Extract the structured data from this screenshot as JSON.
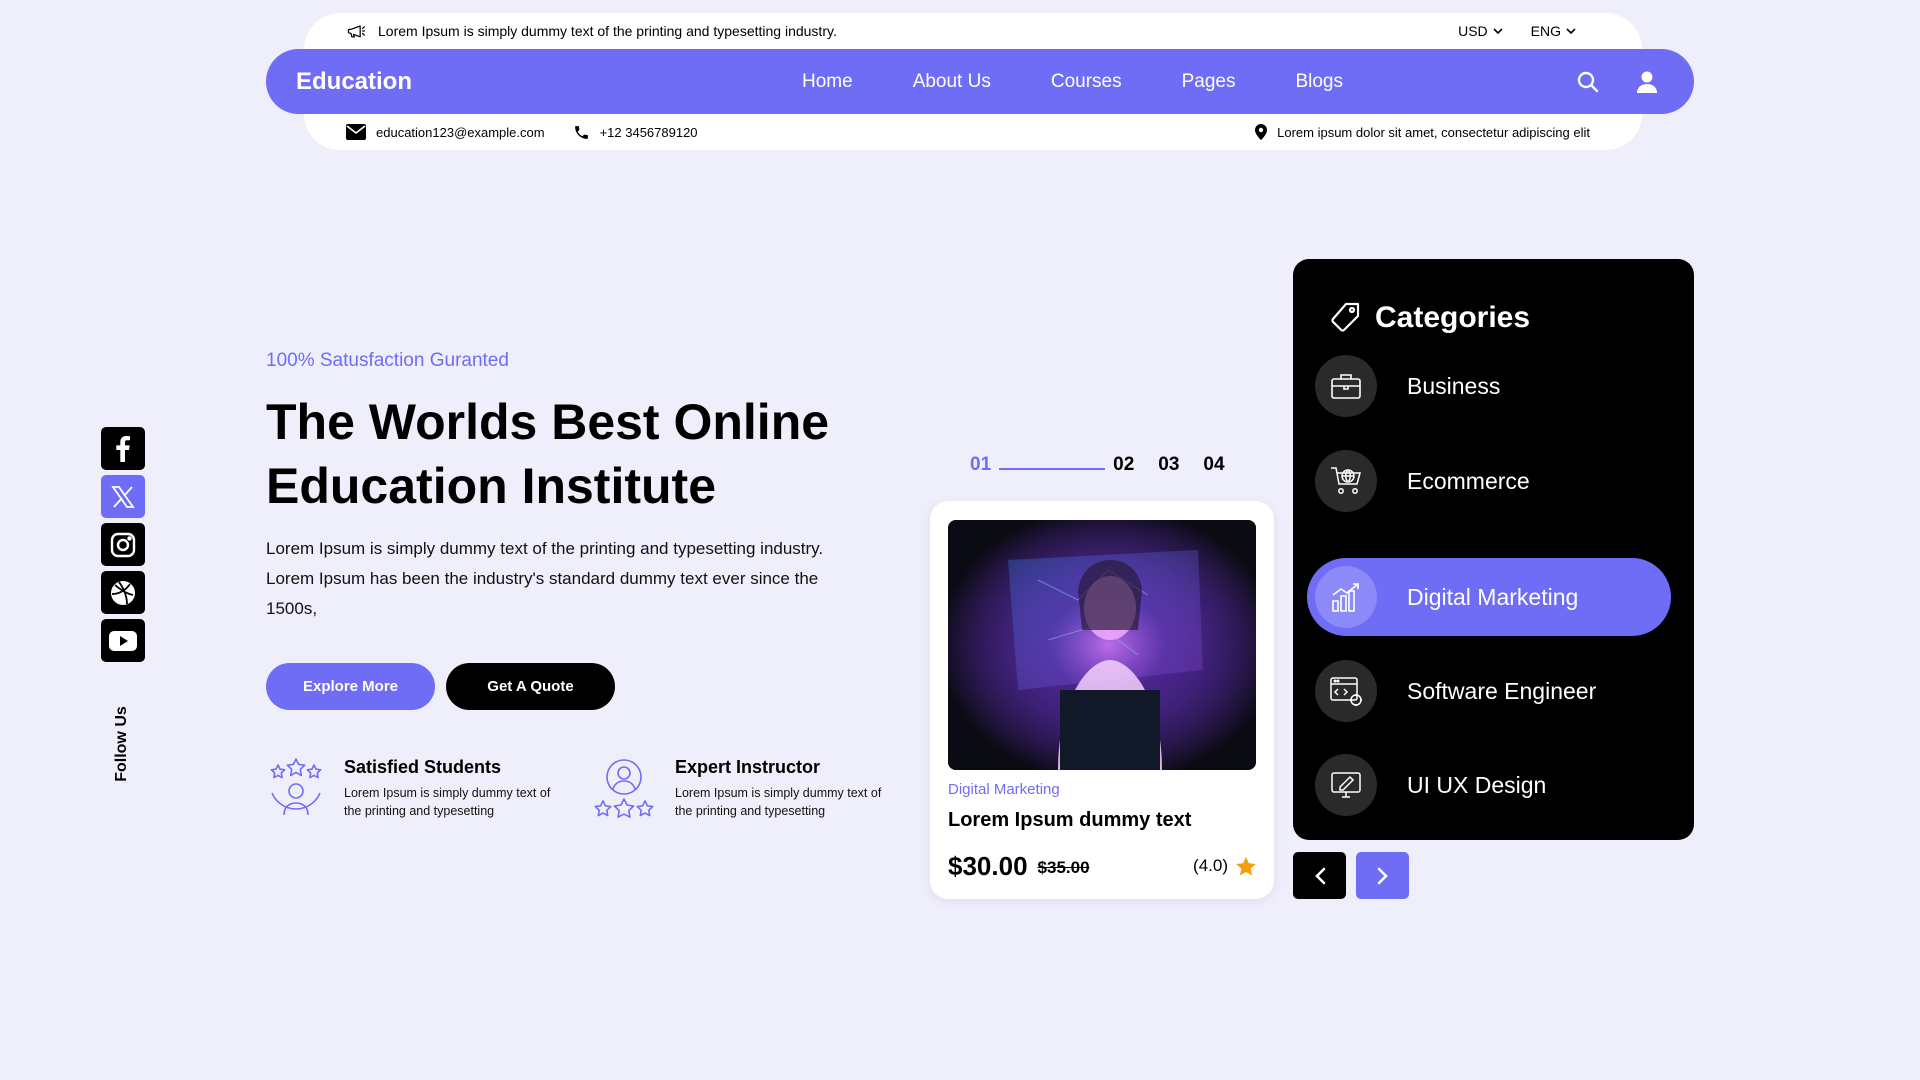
{
  "colors": {
    "accent": "#6f6cf6",
    "background": "#efeffb",
    "dark": "#000000",
    "star": "#f59e0b"
  },
  "topbar": {
    "announcement": "Lorem Ipsum is simply dummy text of the printing and typesetting industry.",
    "currency": "USD",
    "language": "ENG"
  },
  "navbar": {
    "brand": "Education",
    "links": [
      "Home",
      "About Us",
      "Courses",
      "Pages",
      "Blogs"
    ]
  },
  "infobar": {
    "email": "education123@example.com",
    "phone": "+12 3456789120",
    "address": "Lorem ipsum dolor sit amet, consectetur adipiscing elit"
  },
  "social": {
    "icons": [
      "facebook-icon",
      "x-icon",
      "instagram-icon",
      "dribbble-icon",
      "youtube-icon"
    ],
    "follow_label": "Follow Us"
  },
  "hero": {
    "tagline": "100% Satusfaction Guranted",
    "headline_line1": "The Worlds Best Online",
    "headline_line2": "Education Institute",
    "description": "Lorem Ipsum is simply dummy text of the printing and typesetting industry. Lorem Ipsum has been the industry's standard dummy text ever since the 1500s,",
    "explore_button": "Explore More",
    "quote_button": "Get A Quote",
    "features": [
      {
        "title": "Satisfied Students",
        "text": "Lorem Ipsum is simply dummy text of the printing and typesetting"
      },
      {
        "title": "Expert Instructor",
        "text": "Lorem Ipsum is simply dummy text of the printing and typesetting"
      }
    ]
  },
  "slider": {
    "pages": [
      "01",
      "02",
      "03",
      "04"
    ],
    "active_page": "01"
  },
  "course_card": {
    "category": "Digital Marketing",
    "title": "Lorem Ipsum dummy text",
    "price": "$30.00",
    "old_price": "$35.00",
    "rating": "(4.0)"
  },
  "categories": {
    "title": "Categories",
    "items": [
      {
        "label": "Business",
        "icon": "briefcase-icon"
      },
      {
        "label": "Ecommerce",
        "icon": "globe-cart-icon"
      },
      {
        "label": "Digital Marketing",
        "icon": "growth-chart-icon"
      },
      {
        "label": "Software Engineer",
        "icon": "code-window-icon"
      },
      {
        "label": "UI UX Design",
        "icon": "design-monitor-icon"
      }
    ],
    "active": "Digital Marketing"
  }
}
